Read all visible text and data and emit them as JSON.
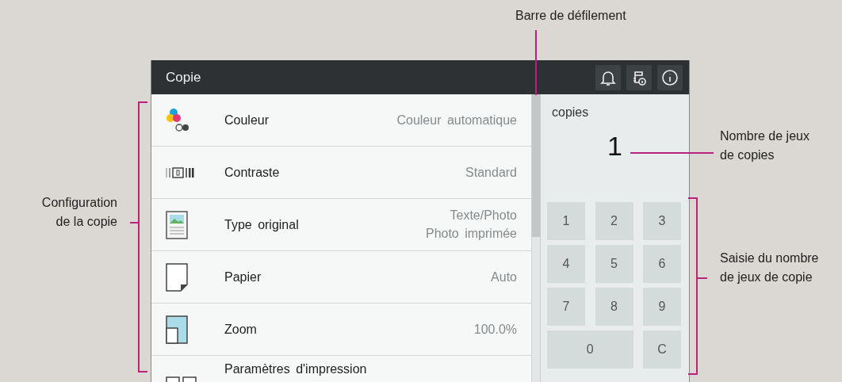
{
  "header": {
    "title": "Copie",
    "icons": [
      {
        "kind": "bell"
      },
      {
        "kind": "printer"
      },
      {
        "kind": "info"
      }
    ]
  },
  "settings": [
    {
      "kind": "color",
      "label": "Couleur",
      "values": [
        "Couleur automatique"
      ]
    },
    {
      "kind": "contrast",
      "label": "Contraste",
      "values": [
        "Standard"
      ]
    },
    {
      "kind": "original",
      "label": "Type original",
      "values": [
        "Texte/Photo",
        "Photo imprimée"
      ]
    },
    {
      "kind": "paper",
      "label": "Papier",
      "values": [
        "Auto"
      ]
    },
    {
      "kind": "zoom",
      "label": "Zoom",
      "values": [
        "100.0%"
      ]
    },
    {
      "kind": "duplex",
      "label": "Paramètres d'impression"
    }
  ],
  "copies": {
    "label": "copies",
    "count": "1",
    "keys": [
      "1",
      "2",
      "3",
      "4",
      "5",
      "6",
      "7",
      "8",
      "9",
      "0",
      "C"
    ]
  },
  "callouts": [
    {
      "kind": "scrollbar",
      "text": "Barre de défilement"
    },
    {
      "kind": "count",
      "text": "Nombre de jeux\nde copies"
    },
    {
      "kind": "settings",
      "text": "Configuration\nde la copie"
    },
    {
      "kind": "keypad",
      "text": "Saisie du nombre\nde jeux de copie"
    }
  ]
}
